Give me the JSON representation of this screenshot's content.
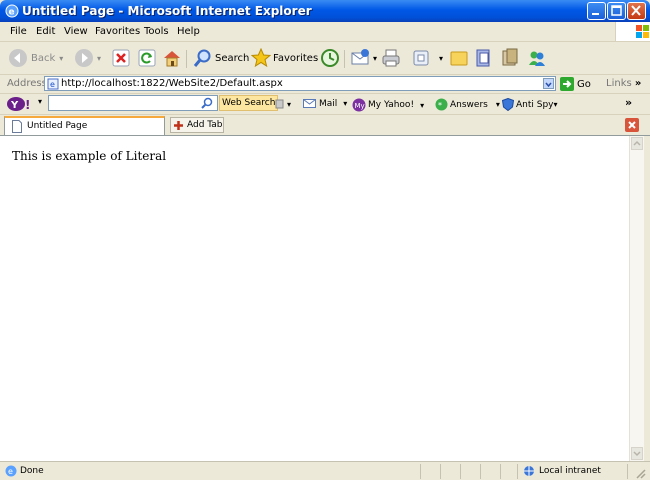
{
  "window": {
    "title": "Untitled Page - Microsoft Internet Explorer"
  },
  "menu": {
    "items": [
      "File",
      "Edit",
      "View",
      "Favorites",
      "Tools",
      "Help"
    ]
  },
  "toolbar": {
    "back_label": "Back",
    "search_label": "Search",
    "favorites_label": "Favorites"
  },
  "address": {
    "label": "Address",
    "url": "http://localhost:1822/WebSite2/Default.aspx",
    "go_label": "Go",
    "links_label": "Links"
  },
  "yahoo": {
    "search_placeholder": "",
    "web_search_label": "Web Search",
    "mail_label": "Mail",
    "my_yahoo_label": "My Yahoo!",
    "answers_label": "Answers",
    "antispy_label": "Anti Spy"
  },
  "tabs": {
    "active_label": "Untitled Page",
    "add_tab_label": "Add Tab"
  },
  "page": {
    "body_text": "This is example of Literal"
  },
  "status": {
    "left_text": "Done",
    "zone_text": "Local intranet"
  },
  "icons": [
    "ie-icon",
    "minimize-icon",
    "maximize-icon",
    "close-icon",
    "windows-logo-icon",
    "back-icon",
    "forward-icon",
    "stop-icon",
    "refresh-icon",
    "home-icon",
    "search-icon",
    "favorites-star-icon",
    "history-icon",
    "mail-icon",
    "print-icon",
    "edit-icon",
    "folder-icon",
    "messenger-icon",
    "yahoo-logo-icon",
    "go-arrow-icon",
    "page-icon",
    "add-tab-icon",
    "close-tab-icon",
    "intranet-icon"
  ],
  "colors": {
    "titlebar": "#0058e6",
    "chrome": "#ece9d8",
    "tab_accent": "#f6a93c",
    "close_red": "#d8553b"
  }
}
